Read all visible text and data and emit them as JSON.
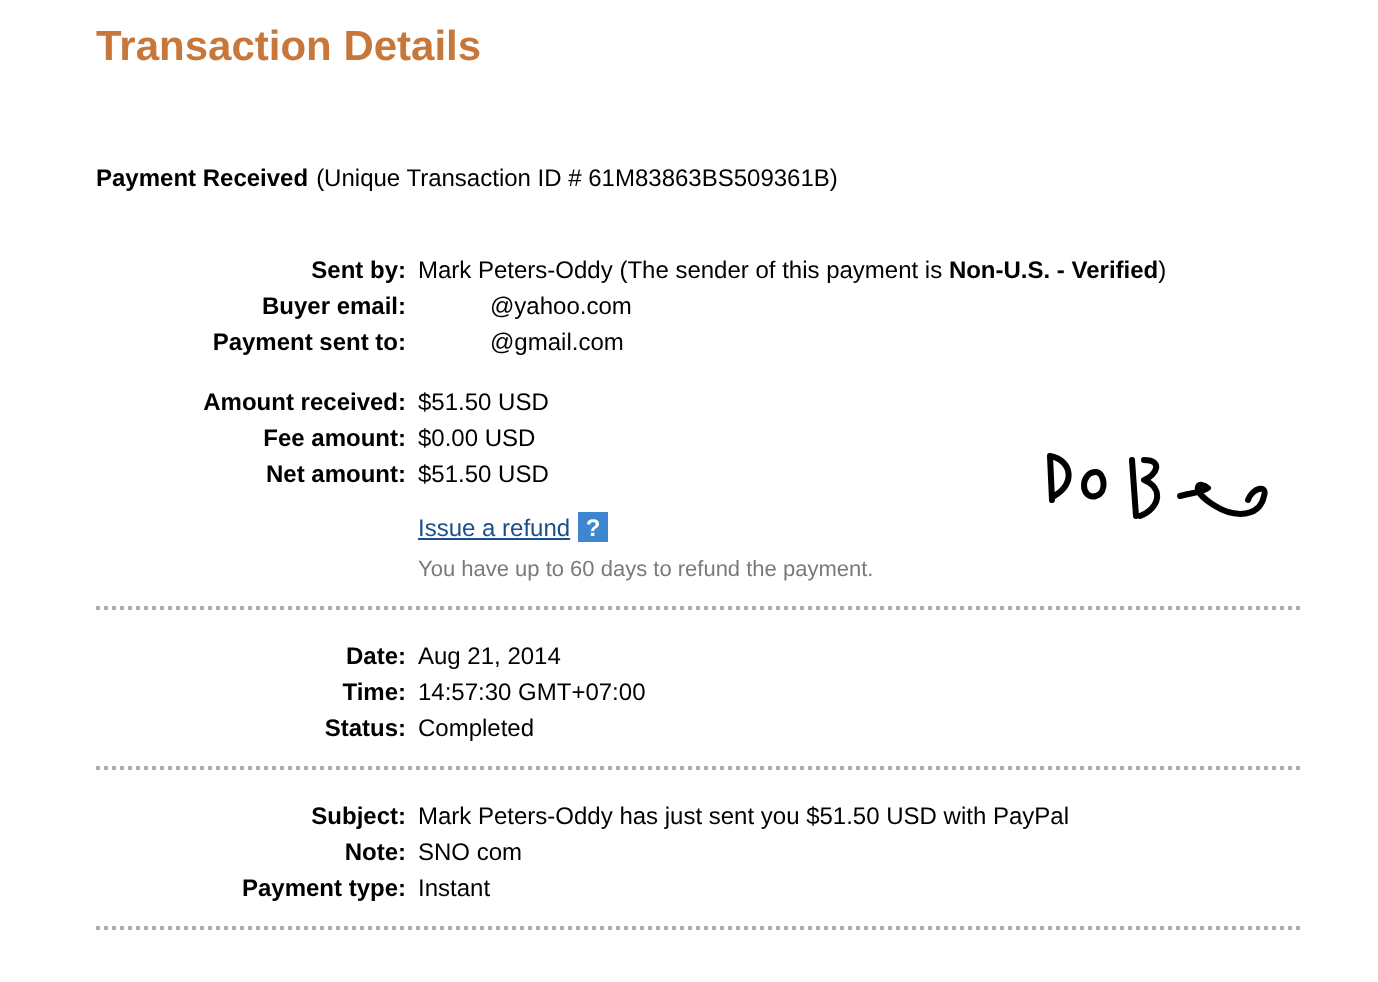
{
  "title": "Transaction Details",
  "header": {
    "label": "Payment Received",
    "detail": "(Unique Transaction ID # 61M83863BS509361B)"
  },
  "sections": [
    {
      "groups": [
        {
          "rows": [
            {
              "label": "Sent by:",
              "value": "Mark Peters-Oddy (The sender of this payment is **Non-U.S. - Verified**)"
            },
            {
              "label": "Buyer email:",
              "value": "@yahoo.com",
              "redacted": true
            },
            {
              "label": "Payment sent to:",
              "value": "@gmail.com",
              "redacted": true
            }
          ]
        },
        {
          "rows": [
            {
              "label": "Amount received:",
              "value": "$51.50 USD"
            },
            {
              "label": "Fee amount:",
              "value": "$0.00 USD"
            },
            {
              "label": "Net amount:",
              "value": "$51.50 USD"
            }
          ]
        }
      ],
      "refund": {
        "link": "Issue a refund",
        "help": "?",
        "note": "You have up to 60 days to refund the payment."
      },
      "handwriting": true
    },
    {
      "groups": [
        {
          "rows": [
            {
              "label": "Date:",
              "value": "Aug 21, 2014"
            },
            {
              "label": "Time:",
              "value": "14:57:30 GMT+07:00"
            },
            {
              "label": "Status:",
              "value": "Completed"
            }
          ]
        }
      ]
    },
    {
      "groups": [
        {
          "rows": [
            {
              "label": "Subject:",
              "value": "Mark Peters-Oddy has just sent you $51.50 USD with PayPal"
            },
            {
              "label": "Note:",
              "value": "SNO com"
            },
            {
              "label": "Payment type:",
              "value": "Instant"
            }
          ]
        }
      ]
    }
  ]
}
